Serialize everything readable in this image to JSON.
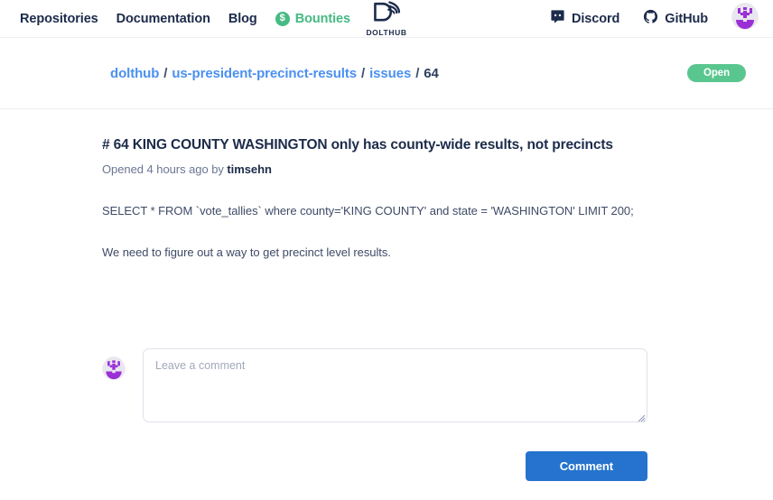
{
  "nav": {
    "links": [
      {
        "label": "Repositories",
        "name": "nav-link-repositories"
      },
      {
        "label": "Documentation",
        "name": "nav-link-documentation"
      },
      {
        "label": "Blog",
        "name": "nav-link-blog"
      }
    ],
    "bounties": {
      "label": "Bounties",
      "icon": "dollar-coin-icon",
      "color": "#46ba83"
    },
    "logo": {
      "wordmark": "DOLTHUB",
      "icon": "dolthub-logo-icon"
    },
    "external": [
      {
        "label": "Discord",
        "icon": "discord-icon"
      },
      {
        "label": "GitHub",
        "icon": "github-icon"
      }
    ],
    "avatar_icon": "user-avatar-identicon"
  },
  "breadcrumb": {
    "owner": "dolthub",
    "repo": "us-president-precinct-results",
    "section": "issues",
    "separator": "/",
    "number": "64"
  },
  "status": {
    "label": "Open",
    "color": "#5ac68f"
  },
  "issue": {
    "title": "# 64 KING COUNTY WASHINGTON only has county-wide results, not precincts",
    "meta_prefix": "Opened 4 hours ago by",
    "author": "timsehn",
    "paragraphs": [
      "SELECT * FROM `vote_tallies` where county='KING COUNTY' and state = 'WASHINGTON' LIMIT 200;",
      "We need to figure out a way to get precinct level results."
    ]
  },
  "comment": {
    "placeholder": "Leave a comment",
    "value": "",
    "avatar_icon": "user-avatar-identicon",
    "submit_label": "Comment",
    "submit_color": "#2573ce"
  }
}
